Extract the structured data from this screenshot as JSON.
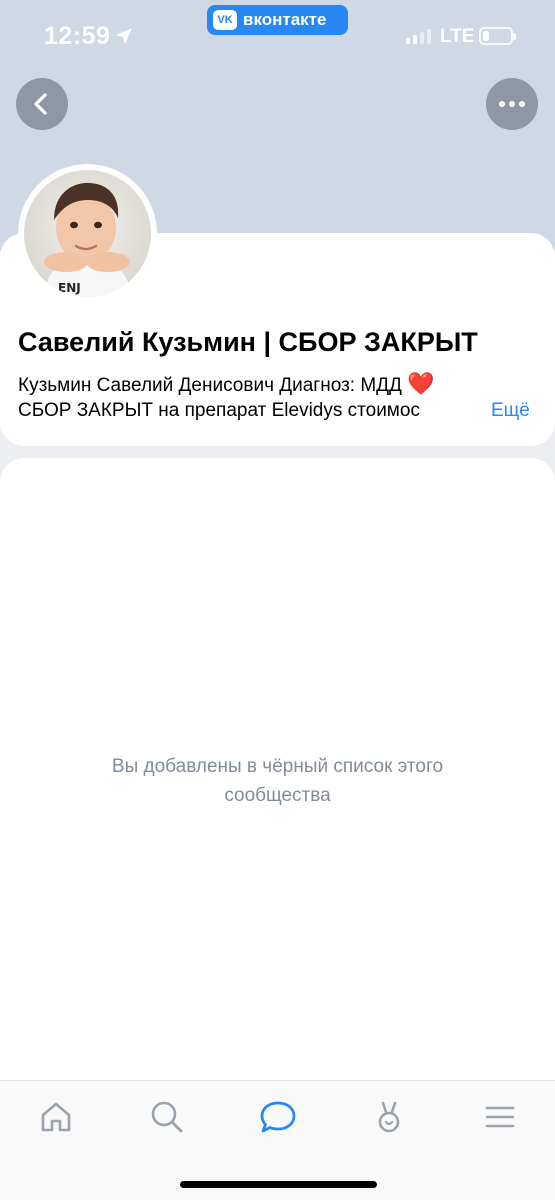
{
  "status_bar": {
    "time": "12:59",
    "network": "LTE",
    "app_badge": "вконтакте",
    "app_badge_logo": "VK",
    "battery_level": 0.2
  },
  "profile": {
    "name": "Савелий Кузьмин | СБОР ЗАКРЫТ",
    "description_line1": "Кузьмин Савелий Денисович  Диагноз: МДД",
    "description_emoji": "❤️",
    "description_line2": "СБОР ЗАКРЫТ на препарат Elevidys стоимос",
    "more_label": "Ещё"
  },
  "content": {
    "blocked_message": "Вы добавлены в чёрный список этого сообщества"
  },
  "tabs": [
    {
      "icon": "home-icon"
    },
    {
      "icon": "search-icon"
    },
    {
      "icon": "messages-icon"
    },
    {
      "icon": "clips-icon"
    },
    {
      "icon": "menu-icon"
    }
  ],
  "colors": {
    "accent": "#2787f5",
    "header": "#d0d8e6",
    "muted_text": "#818c99",
    "tab_icon": "#99a2ad"
  }
}
